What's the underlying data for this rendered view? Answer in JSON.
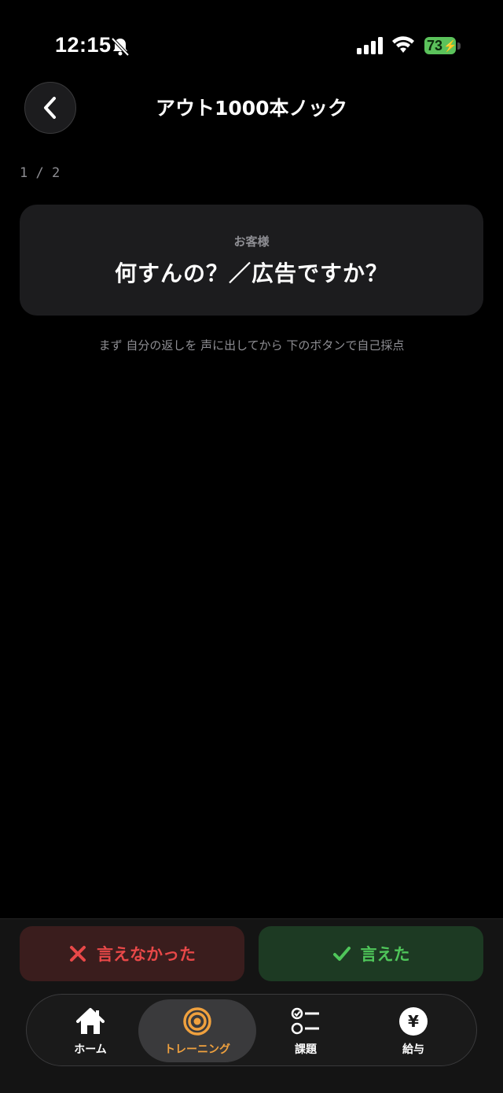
{
  "status_bar": {
    "time": "12:15",
    "battery": "73",
    "icons": [
      "bell-off-icon",
      "signal-icon",
      "wifi-icon",
      "battery-icon"
    ]
  },
  "header": {
    "title": "アウト1000本ノック",
    "back_icon": "chevron-left-icon"
  },
  "progress": {
    "counter": "1 / 2"
  },
  "prompt": {
    "speaker": "お客様",
    "text": "何すんの？／広告ですか？"
  },
  "instruction": "まず 自分の返しを 声に出してから 下のボタンで自己採点",
  "answer_buttons": {
    "fail_label": "言えなかった",
    "success_label": "言えた"
  },
  "tabs": [
    {
      "label": "ホーム",
      "icon": "home-icon",
      "active": false
    },
    {
      "label": "トレーニング",
      "icon": "target-icon",
      "active": true
    },
    {
      "label": "課題",
      "icon": "checklist-icon",
      "active": false
    },
    {
      "label": "給与",
      "icon": "yen-icon",
      "active": false
    }
  ],
  "colors": {
    "background": "#000000",
    "card": "#1c1c1e",
    "accent_active": "#f0a13e",
    "fail": "#e84848",
    "success": "#4fc65a",
    "battery": "#5bc25b"
  }
}
